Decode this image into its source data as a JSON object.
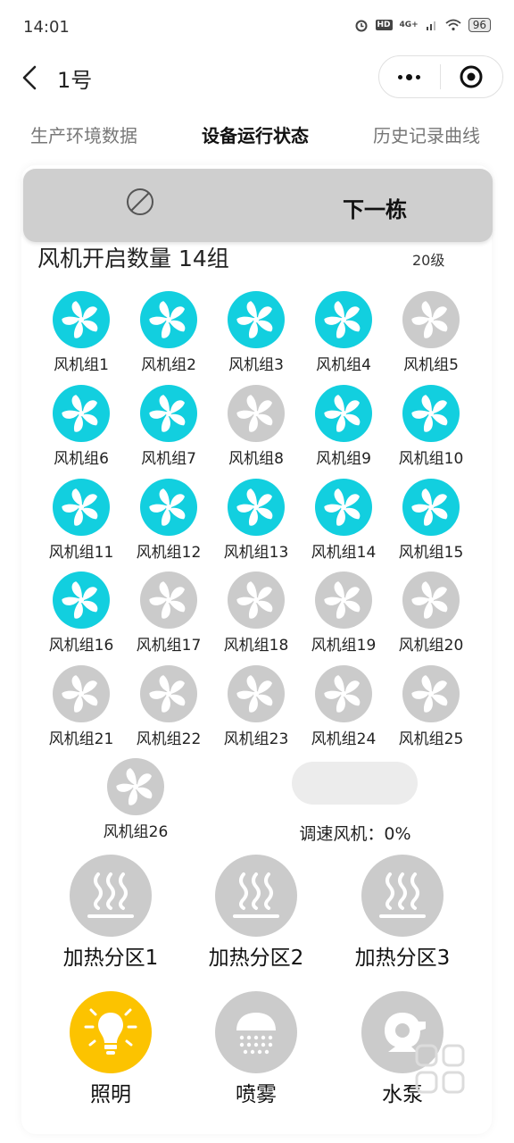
{
  "status_bar": {
    "time": "14:01",
    "network": "4G+",
    "hd": "HD",
    "battery": "96"
  },
  "nav": {
    "title": "1号"
  },
  "tabs": [
    {
      "label": "生产环境数据",
      "active": false
    },
    {
      "label": "设备运行状态",
      "active": true
    },
    {
      "label": "历史记录曲线",
      "active": false
    }
  ],
  "next_button": {
    "label": "下一栋"
  },
  "summary": {
    "fan_count_text": "风机开启数量 14组",
    "level": "20级"
  },
  "fans": [
    {
      "label": "风机组1",
      "on": true
    },
    {
      "label": "风机组2",
      "on": true
    },
    {
      "label": "风机组3",
      "on": true
    },
    {
      "label": "风机组4",
      "on": true
    },
    {
      "label": "风机组5",
      "on": false
    },
    {
      "label": "风机组6",
      "on": true
    },
    {
      "label": "风机组7",
      "on": true
    },
    {
      "label": "风机组8",
      "on": false
    },
    {
      "label": "风机组9",
      "on": true
    },
    {
      "label": "风机组10",
      "on": true
    },
    {
      "label": "风机组11",
      "on": true
    },
    {
      "label": "风机组12",
      "on": true
    },
    {
      "label": "风机组13",
      "on": true
    },
    {
      "label": "风机组14",
      "on": true
    },
    {
      "label": "风机组15",
      "on": true
    },
    {
      "label": "风机组16",
      "on": true
    },
    {
      "label": "风机组17",
      "on": false
    },
    {
      "label": "风机组18",
      "on": false
    },
    {
      "label": "风机组19",
      "on": false
    },
    {
      "label": "风机组20",
      "on": false
    },
    {
      "label": "风机组21",
      "on": false
    },
    {
      "label": "风机组22",
      "on": false
    },
    {
      "label": "风机组23",
      "on": false
    },
    {
      "label": "风机组24",
      "on": false
    },
    {
      "label": "风机组25",
      "on": false
    },
    {
      "label": "风机组26",
      "on": false
    }
  ],
  "speed_fan": {
    "text": "调速风机：0%",
    "percent": 0
  },
  "heaters": [
    {
      "label": "加热分区1",
      "on": false
    },
    {
      "label": "加热分区2",
      "on": false
    },
    {
      "label": "加热分区3",
      "on": false
    }
  ],
  "devices": [
    {
      "label": "照明",
      "icon": "bulb-icon",
      "on": true
    },
    {
      "label": "喷雾",
      "icon": "spray-icon",
      "on": false
    },
    {
      "label": "水泵",
      "icon": "pump-icon",
      "on": false
    }
  ],
  "colors": {
    "fan_on": "#12cfdf",
    "off": "#cbcbcb",
    "light_on": "#fcc300"
  }
}
